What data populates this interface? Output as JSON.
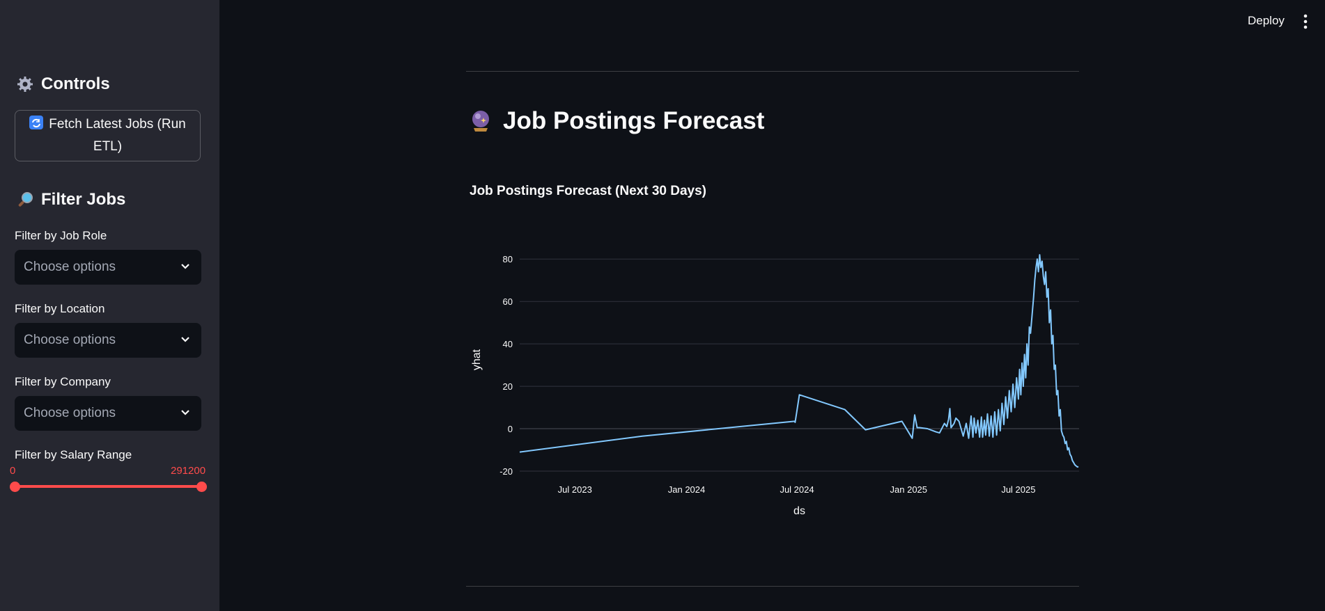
{
  "sidebar": {
    "controls_heading": "Controls",
    "controls_icon": "gear-icon",
    "fetch_button_label": "Fetch Latest Jobs (Run ETL)",
    "fetch_button_icon": "refresh-icon",
    "filter_heading": "Filter Jobs",
    "filter_icon": "magnifier-icon",
    "filters": [
      {
        "label": "Filter by Job Role",
        "placeholder": "Choose options"
      },
      {
        "label": "Filter by Location",
        "placeholder": "Choose options"
      },
      {
        "label": "Filter by Company",
        "placeholder": "Choose options"
      }
    ],
    "salary": {
      "label": "Filter by Salary Range",
      "min": "0",
      "max": "291200"
    }
  },
  "header": {
    "deploy_label": "Deploy",
    "menu_icon": "more-vertical-icon"
  },
  "main": {
    "title": "Job Postings Forecast",
    "title_icon": "crystal-ball-icon",
    "chart_title": "Job Postings Forecast (Next 30 Days)"
  },
  "colors": {
    "background": "#0e1117",
    "sidebar": "#262730",
    "accent": "#ff4b4b",
    "line": "#83c9ff"
  },
  "chart_data": {
    "type": "line",
    "xlabel": "ds",
    "ylabel": "yhat",
    "x_tick_labels": [
      "Jul 2023",
      "Jan 2024",
      "Jul 2024",
      "Jan 2025",
      "Jul 2025"
    ],
    "x_ticks": [
      "2023-07-01",
      "2024-01-01",
      "2024-07-01",
      "2025-01-01",
      "2025-07-01"
    ],
    "y_ticks": [
      -20,
      0,
      20,
      40,
      60,
      80
    ],
    "ylim": [
      -20,
      85
    ],
    "xlim": [
      "2023-04-01",
      "2025-10-09"
    ],
    "grid": true,
    "series": [
      {
        "x": [
          "2023-04-01",
          "2023-10-20",
          "2024-06-27",
          "2024-06-28",
          "2024-07-05",
          "2024-09-18",
          "2024-10-22",
          "2024-12-21",
          "2025-01-07",
          "2025-01-11",
          "2025-01-15",
          "2025-01-19",
          "2025-02-01",
          "2025-02-15",
          "2025-02-21",
          "2025-03-01",
          "2025-03-05",
          "2025-03-08",
          "2025-03-10",
          "2025-03-12",
          "2025-03-17",
          "2025-03-20",
          "2025-03-25",
          "2025-04-01",
          "2025-04-06",
          "2025-04-10",
          "2025-04-14",
          "2025-04-17",
          "2025-04-19",
          "2025-04-22",
          "2025-04-25",
          "2025-04-28",
          "2025-05-01",
          "2025-05-03",
          "2025-05-06",
          "2025-05-08",
          "2025-05-11",
          "2025-05-14",
          "2025-05-17",
          "2025-05-20",
          "2025-05-23",
          "2025-05-26",
          "2025-05-29",
          "2025-06-01",
          "2025-06-04",
          "2025-06-07",
          "2025-06-10",
          "2025-06-13",
          "2025-06-16",
          "2025-06-19",
          "2025-06-22",
          "2025-06-25",
          "2025-06-28",
          "2025-07-01",
          "2025-07-03",
          "2025-07-05",
          "2025-07-07",
          "2025-07-09",
          "2025-07-11",
          "2025-07-13",
          "2025-07-15",
          "2025-07-17",
          "2025-07-19",
          "2025-07-21",
          "2025-07-24",
          "2025-07-26",
          "2025-07-28",
          "2025-07-30",
          "2025-08-01",
          "2025-08-03",
          "2025-08-05",
          "2025-08-07",
          "2025-08-09",
          "2025-08-11",
          "2025-08-13",
          "2025-08-15",
          "2025-08-17",
          "2025-08-19",
          "2025-08-21",
          "2025-08-23",
          "2025-08-25",
          "2025-08-27",
          "2025-08-29",
          "2025-08-31",
          "2025-09-02",
          "2025-09-04",
          "2025-09-06",
          "2025-09-08",
          "2025-09-10",
          "2025-09-12",
          "2025-09-14",
          "2025-09-16",
          "2025-09-18",
          "2025-09-20",
          "2025-09-22",
          "2025-09-24",
          "2025-09-26",
          "2025-09-28",
          "2025-09-30",
          "2025-10-02",
          "2025-10-04",
          "2025-10-06",
          "2025-10-08"
        ],
        "y": [
          -11,
          -3.5,
          3.5,
          3,
          16,
          9,
          -0.5,
          3.5,
          -4.5,
          6.5,
          0.5,
          0.5,
          0,
          -1.5,
          -2,
          2.5,
          1,
          4.5,
          9.5,
          0.5,
          2.5,
          5,
          3.5,
          -3.5,
          2.5,
          -4.5,
          6,
          -4,
          5,
          -2,
          4,
          -4,
          5.5,
          -4,
          4,
          -3,
          7,
          -3.5,
          6,
          -4,
          8,
          -3,
          9,
          -1,
          12,
          2,
          15,
          5,
          18,
          8,
          21,
          10,
          24,
          14,
          28,
          16,
          31,
          20,
          35,
          24,
          40,
          30,
          48,
          45,
          55,
          62,
          70,
          76,
          80,
          74,
          82,
          76,
          79,
          72,
          68,
          74,
          62,
          66,
          50,
          56,
          40,
          44,
          28,
          30,
          16,
          18,
          6,
          9,
          -1,
          -3,
          -4,
          -7,
          -6,
          -10,
          -9,
          -12,
          -13,
          -15,
          -16,
          -17,
          -17.5,
          -18,
          -18
        ]
      }
    ]
  }
}
